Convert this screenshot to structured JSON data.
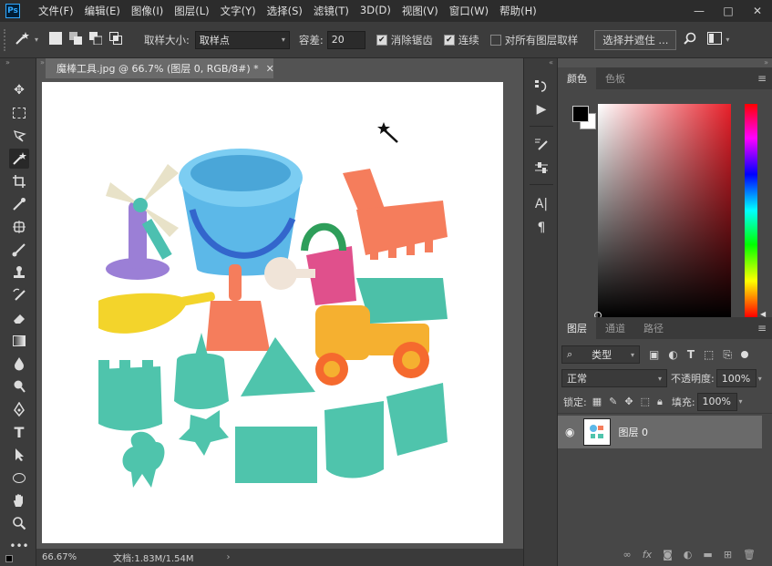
{
  "app": {
    "logo": "Ps"
  },
  "menu": [
    "文件(F)",
    "编辑(E)",
    "图像(I)",
    "图层(L)",
    "文字(Y)",
    "选择(S)",
    "滤镜(T)",
    "3D(D)",
    "视图(V)",
    "窗口(W)",
    "帮助(H)"
  ],
  "window_controls": {
    "minimize": "—",
    "restore": "□",
    "close": "✕"
  },
  "options": {
    "sample_size_label": "取样大小:",
    "sample_size_value": "取样点",
    "tolerance_label": "容差:",
    "tolerance_value": "20",
    "anti_alias_label": "消除锯齿",
    "anti_alias_checked": true,
    "contiguous_label": "连续",
    "contiguous_checked": true,
    "sample_all_label": "对所有图层取样",
    "sample_all_checked": false,
    "select_mask_label": "选择并遮住 ..."
  },
  "document": {
    "tab_title": "魔棒工具.jpg @ 66.7% (图层 0, RGB/8#) *",
    "zoom": "66.67%",
    "doc_size": "文档:1.83M/1.54M"
  },
  "tools": [
    "move-tool",
    "marquee-tool",
    "lasso-tool",
    "magic-wand-tool",
    "crop-tool",
    "eyedropper-tool",
    "healing-tool",
    "brush-tool",
    "stamp-tool",
    "history-brush-tool",
    "eraser-tool",
    "gradient-tool",
    "blur-tool",
    "dodge-tool",
    "pen-tool",
    "type-tool",
    "path-select-tool",
    "shape-tool",
    "hand-tool",
    "zoom-tool"
  ],
  "color_panel": {
    "tabs": [
      "颜色",
      "色板"
    ],
    "foreground": "#000000",
    "background": "#ffffff"
  },
  "layers_panel": {
    "tabs": [
      "图层",
      "通道",
      "路径"
    ],
    "filter_kind": "类型",
    "blend_mode": "正常",
    "opacity_label": "不透明度:",
    "opacity_value": "100%",
    "lock_label": "锁定:",
    "fill_label": "填充:",
    "fill_value": "100%",
    "layers": [
      {
        "name": "图层 0",
        "visible": true
      }
    ]
  },
  "colors": {
    "accent": "#31a8ff"
  }
}
